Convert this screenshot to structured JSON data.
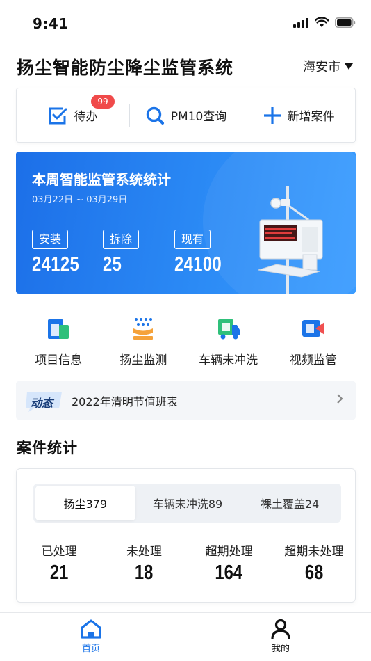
{
  "status_bar": {
    "time": "9:41"
  },
  "header": {
    "title": "扬尘智能防尘降尘监管系统",
    "city": "海安市"
  },
  "quick_actions": [
    {
      "label": "待办",
      "badge": "99"
    },
    {
      "label": "PM10查询"
    },
    {
      "label": "新增案件"
    }
  ],
  "banner": {
    "title": "本周智能监管系统统计",
    "date_range": "03月22日 ~ 03月29日",
    "stats": [
      {
        "label": "安装",
        "value": "24125"
      },
      {
        "label": "拆除",
        "value": "25"
      },
      {
        "label": "现有",
        "value": "24100"
      }
    ]
  },
  "menu": [
    {
      "label": "项目信息",
      "icon": "project-info-icon"
    },
    {
      "label": "扬尘监测",
      "icon": "dust-monitor-icon"
    },
    {
      "label": "车辆未冲洗",
      "icon": "vehicle-unwashed-icon"
    },
    {
      "label": "视频监管",
      "icon": "video-monitor-icon"
    }
  ],
  "news": {
    "tag": "动态",
    "text": "2022年清明节值班表"
  },
  "case_stats": {
    "title": "案件统计",
    "tabs": [
      "扬尘379",
      "车辆未冲洗89",
      "裸土覆盖24"
    ],
    "active_tab": 0,
    "counts": [
      {
        "label": "已处理",
        "value": "21"
      },
      {
        "label": "未处理",
        "value": "18"
      },
      {
        "label": "超期处理",
        "value": "164"
      },
      {
        "label": "超期未处理",
        "value": "68"
      }
    ]
  },
  "tabbar": [
    {
      "label": "首页",
      "active": true
    },
    {
      "label": "我的",
      "active": false
    }
  ],
  "colors": {
    "accent": "#1b74e8",
    "badge": "#f04a4a",
    "orange": "#f5a23a",
    "green": "#2fc07a",
    "red": "#f05050"
  }
}
